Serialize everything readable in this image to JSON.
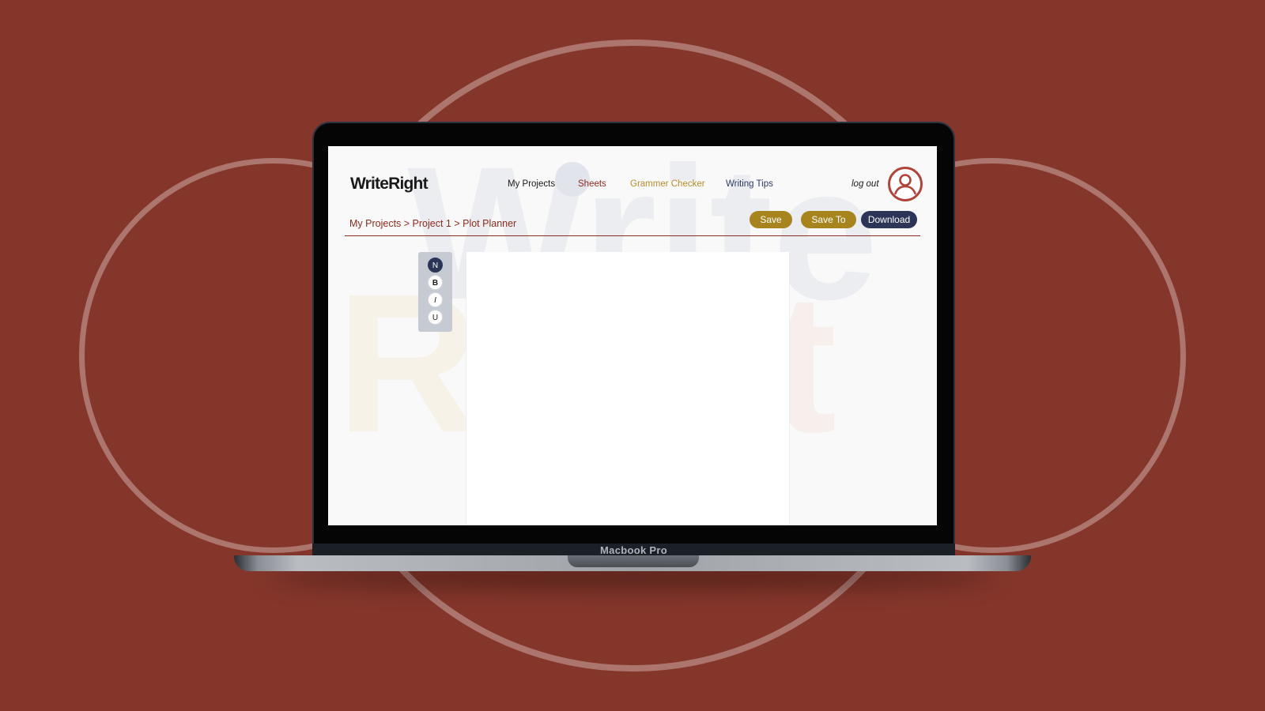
{
  "app": {
    "logo": "WriteRight",
    "watermark": {
      "line1": "Write",
      "line2_left": "R",
      "line2_right": "t"
    }
  },
  "nav": {
    "items": [
      {
        "label": "My Projects",
        "color": "#1a1a1a"
      },
      {
        "label": "Sheets",
        "color": "#8b2b20"
      },
      {
        "label": "Grammer Checker",
        "color": "#b78b2c"
      },
      {
        "label": "Writing Tips",
        "color": "#2c3a63"
      }
    ],
    "logout": "log out",
    "avatar_icon": "user-avatar-icon"
  },
  "breadcrumb": "My Projects > Project 1 > Plot Planner",
  "actions": {
    "save": "Save",
    "save_to": "Save To",
    "download": "Download"
  },
  "format_toolbar": [
    {
      "label": "N",
      "name": "normal",
      "active": true
    },
    {
      "label": "B",
      "name": "bold",
      "active": false
    },
    {
      "label": "I",
      "name": "italic",
      "active": false
    },
    {
      "label": "U",
      "name": "underline",
      "active": false
    }
  ],
  "device": {
    "label": "Macbook Pro"
  },
  "colors": {
    "background": "#85362b",
    "brand_red": "#8b2b20",
    "gold": "#a8841f",
    "navy": "#2c3557"
  }
}
